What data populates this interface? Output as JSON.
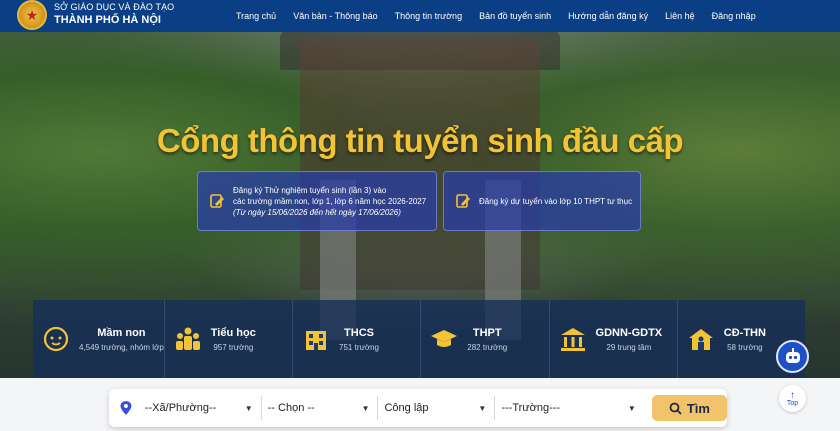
{
  "brand": {
    "line1": "SỞ GIÁO DỤC VÀ ĐÀO TẠO",
    "line2": "THÀNH PHỐ HÀ NỘI"
  },
  "nav": [
    "Trang chủ",
    "Văn bản - Thông báo",
    "Thông tin trường",
    "Bản đồ tuyển sinh",
    "Hướng dẫn đăng ký",
    "Liên hệ",
    "Đăng nhập"
  ],
  "hero": {
    "title": "Cổng thông tin tuyển sinh đầu cấp"
  },
  "notices": {
    "n1_line1": "Đăng ký Thử nghiệm tuyển sinh (lần 3) vào",
    "n1_line2": "các trường mầm non, lớp 1, lớp 6 năm học 2026-2027",
    "n1_line3": "(Từ ngày 15/06/2026 đến hết ngày 17/06/2026)",
    "n2": "Đăng ký dự tuyển vào lớp 10 THPT tư thục"
  },
  "categories": [
    {
      "name": "Mầm non",
      "count": "4,549 trường, nhóm lớp",
      "icon": "child-face-icon"
    },
    {
      "name": "Tiểu học",
      "count": "957 trường",
      "icon": "students-icon"
    },
    {
      "name": "THCS",
      "count": "751 trường",
      "icon": "building-icon"
    },
    {
      "name": "THPT",
      "count": "282 trường",
      "icon": "graduation-cap-icon"
    },
    {
      "name": "GDNN-GDTX",
      "count": "29 trung tâm",
      "icon": "institution-icon"
    },
    {
      "name": "CĐ-THN",
      "count": "58 trường",
      "icon": "house-person-icon"
    }
  ],
  "search": {
    "ward": "--Xã/Phường--",
    "choose": "-- Chọn --",
    "type": "Công lập",
    "school": "---Trường---",
    "button": "Tìm"
  },
  "top_label": "Top",
  "colors": {
    "header": "#0a3f86",
    "accent": "#f2c335",
    "button": "#f1c36a",
    "pin": "#3a4fd8"
  }
}
